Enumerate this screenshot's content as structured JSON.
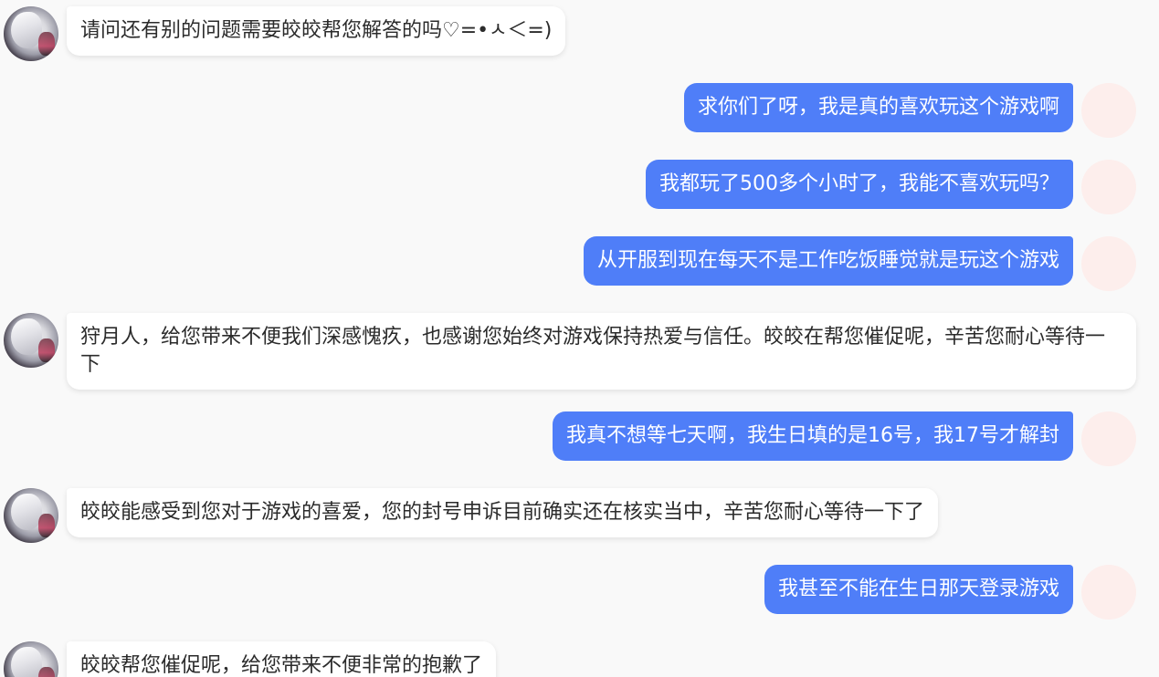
{
  "messages": [
    {
      "sender": "agent",
      "text": "请问还有别的问题需要皎皎帮您解答的吗♡=•ㅅ＜=)"
    },
    {
      "sender": "user",
      "text": "求你们了呀，我是真的喜欢玩这个游戏啊"
    },
    {
      "sender": "user",
      "text": "我都玩了500多个小时了，我能不喜欢玩吗？"
    },
    {
      "sender": "user",
      "text": "从开服到现在每天不是工作吃饭睡觉就是玩这个游戏"
    },
    {
      "sender": "agent",
      "text": "狩月人，给您带来不便我们深感愧疚，也感谢您始终对游戏保持热爱与信任。皎皎在帮您催促呢，辛苦您耐心等待一下"
    },
    {
      "sender": "user",
      "text": "我真不想等七天啊，我生日填的是16号，我17号才解封"
    },
    {
      "sender": "agent",
      "text": "皎皎能感受到您对于游戏的喜爱，您的封号申诉目前确实还在核实当中，辛苦您耐心等待一下了"
    },
    {
      "sender": "user",
      "text": "我甚至不能在生日那天登录游戏"
    },
    {
      "sender": "agent",
      "text": "皎皎帮您催促呢，给您带来不便非常的抱歉了"
    }
  ],
  "colors": {
    "background": "#f9f9f9",
    "user_bubble": "#4f7ef8",
    "agent_bubble": "#ffffff",
    "user_avatar": "#fdeeec"
  }
}
